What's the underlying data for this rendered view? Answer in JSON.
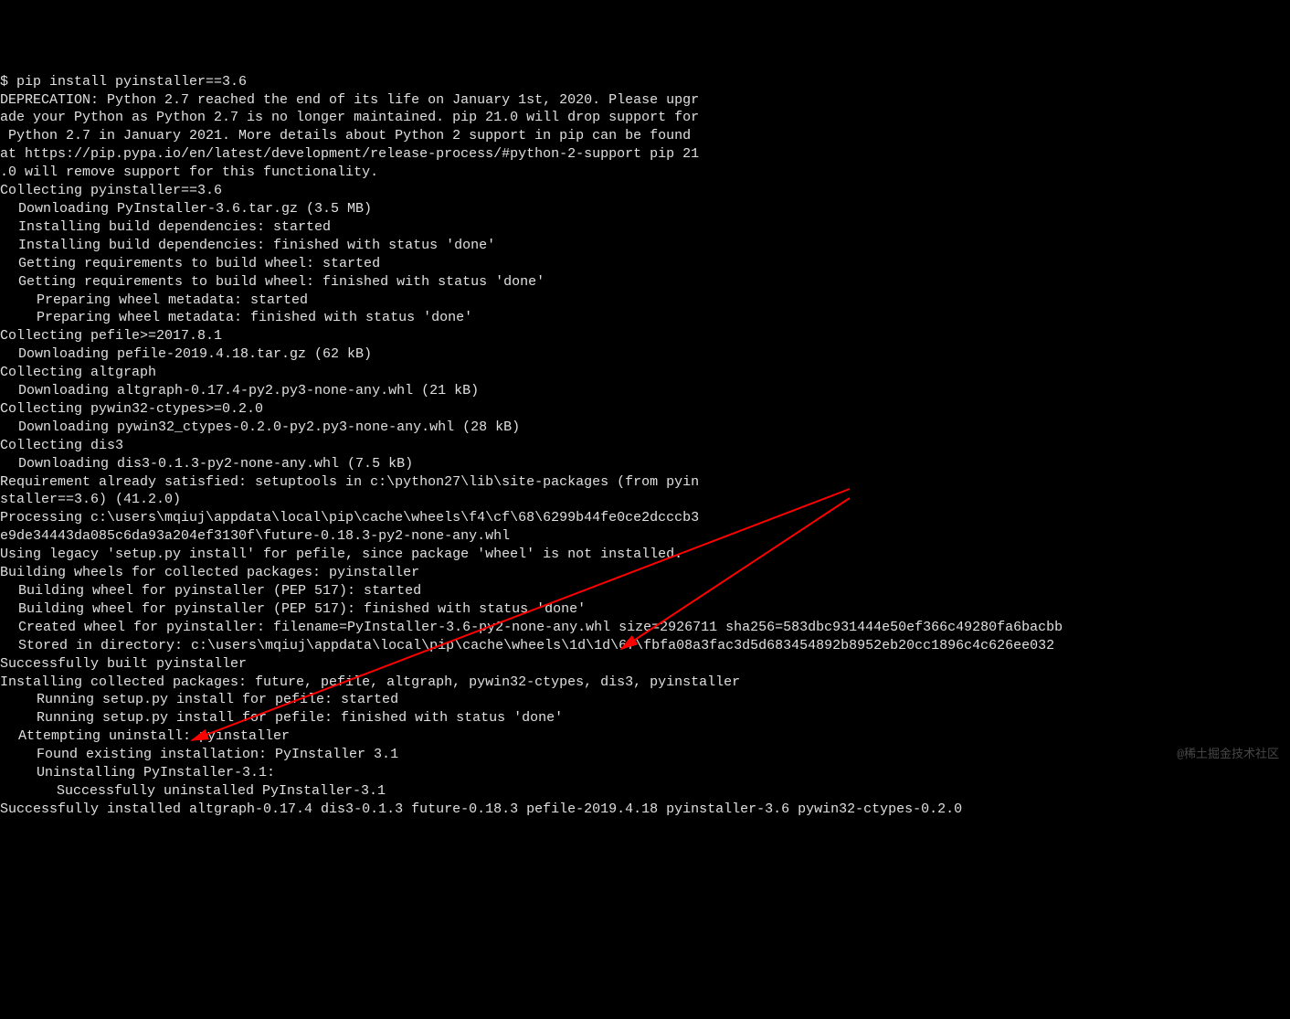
{
  "terminal": {
    "lines": [
      {
        "indent": 0,
        "text": "$ pip install pyinstaller==3.6"
      },
      {
        "indent": 0,
        "text": "DEPRECATION: Python 2.7 reached the end of its life on January 1st, 2020. Please upgr"
      },
      {
        "indent": 0,
        "text": "ade your Python as Python 2.7 is no longer maintained. pip 21.0 will drop support for"
      },
      {
        "indent": 0,
        "text": " Python 2.7 in January 2021. More details about Python 2 support in pip can be found "
      },
      {
        "indent": 0,
        "text": "at https://pip.pypa.io/en/latest/development/release-process/#python-2-support pip 21"
      },
      {
        "indent": 0,
        "text": ".0 will remove support for this functionality."
      },
      {
        "indent": 0,
        "text": "Collecting pyinstaller==3.6"
      },
      {
        "indent": 1,
        "text": "Downloading PyInstaller-3.6.tar.gz (3.5 MB)"
      },
      {
        "indent": 0,
        "text": ""
      },
      {
        "indent": 1,
        "text": "Installing build dependencies: started"
      },
      {
        "indent": 1,
        "text": "Installing build dependencies: finished with status 'done'"
      },
      {
        "indent": 1,
        "text": "Getting requirements to build wheel: started"
      },
      {
        "indent": 1,
        "text": "Getting requirements to build wheel: finished with status 'done'"
      },
      {
        "indent": 2,
        "text": "Preparing wheel metadata: started"
      },
      {
        "indent": 2,
        "text": "Preparing wheel metadata: finished with status 'done'"
      },
      {
        "indent": 0,
        "text": "Collecting pefile>=2017.8.1"
      },
      {
        "indent": 1,
        "text": "Downloading pefile-2019.4.18.tar.gz (62 kB)"
      },
      {
        "indent": 0,
        "text": "Collecting altgraph"
      },
      {
        "indent": 1,
        "text": "Downloading altgraph-0.17.4-py2.py3-none-any.whl (21 kB)"
      },
      {
        "indent": 0,
        "text": "Collecting pywin32-ctypes>=0.2.0"
      },
      {
        "indent": 1,
        "text": "Downloading pywin32_ctypes-0.2.0-py2.py3-none-any.whl (28 kB)"
      },
      {
        "indent": 0,
        "text": "Collecting dis3"
      },
      {
        "indent": 1,
        "text": "Downloading dis3-0.1.3-py2-none-any.whl (7.5 kB)"
      },
      {
        "indent": 0,
        "text": "Requirement already satisfied: setuptools in c:\\python27\\lib\\site-packages (from pyin"
      },
      {
        "indent": 0,
        "text": "staller==3.6) (41.2.0)"
      },
      {
        "indent": 0,
        "text": "Processing c:\\users\\mqiuj\\appdata\\local\\pip\\cache\\wheels\\f4\\cf\\68\\6299b44fe0ce2dcccb3"
      },
      {
        "indent": 0,
        "text": "e9de34443da085c6da93a204ef3130f\\future-0.18.3-py2-none-any.whl"
      },
      {
        "indent": 0,
        "text": "Using legacy 'setup.py install' for pefile, since package 'wheel' is not installed."
      },
      {
        "indent": 0,
        "text": "Building wheels for collected packages: pyinstaller"
      },
      {
        "indent": 1,
        "text": "Building wheel for pyinstaller (PEP 517): started"
      },
      {
        "indent": 1,
        "text": "Building wheel for pyinstaller (PEP 517): finished with status 'done'"
      },
      {
        "indent": 1,
        "text": "Created wheel for pyinstaller: filename=PyInstaller-3.6-py2-none-any.whl size=2926711 sha256=583dbc931444e50ef366c49280fa6bacbb"
      },
      {
        "indent": 1,
        "text": "Stored in directory: c:\\users\\mqiuj\\appdata\\local\\pip\\cache\\wheels\\1d\\1d\\67\\fbfa08a3fac3d5d683454892b8952eb20cc1896c4c626ee032"
      },
      {
        "indent": 0,
        "text": "Successfully built pyinstaller"
      },
      {
        "indent": 0,
        "text": "Installing collected packages: future, pefile, altgraph, pywin32-ctypes, dis3, pyinstaller"
      },
      {
        "indent": 2,
        "text": "Running setup.py install for pefile: started"
      },
      {
        "indent": 2,
        "text": "Running setup.py install for pefile: finished with status 'done'"
      },
      {
        "indent": 1,
        "text": "Attempting uninstall: pyinstaller"
      },
      {
        "indent": 2,
        "text": "Found existing installation: PyInstaller 3.1"
      },
      {
        "indent": 2,
        "text": "Uninstalling PyInstaller-3.1:"
      },
      {
        "indent": 3,
        "text": "Successfully uninstalled PyInstaller-3.1"
      },
      {
        "indent": 0,
        "text": "Successfully installed altgraph-0.17.4 dis3-0.1.3 future-0.18.3 pefile-2019.4.18 pyinstaller-3.6 pywin32-ctypes-0.2.0"
      }
    ]
  },
  "watermark": "@稀土掘金技术社区",
  "annotations": {
    "arrow_color": "#ff0000"
  }
}
